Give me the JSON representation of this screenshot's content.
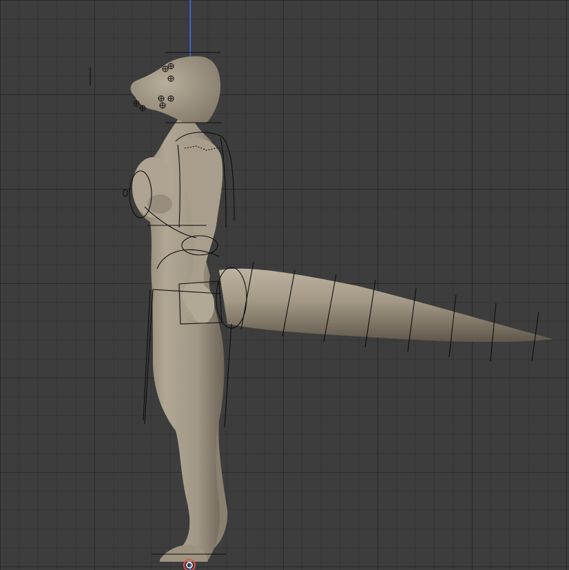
{
  "viewport": {
    "view": "side",
    "background_color": "#3d3d3d",
    "grid_color": "#2a2a2a",
    "axis_color": "#3a6fd8",
    "mesh_color": "#a19786",
    "mesh_shadow_color": "#6e6558",
    "rig_line_color": "#0d0d0d",
    "origin_marker_color": "#e05050"
  },
  "model": {
    "icon": "sculpt-model",
    "rig": "armature-overlay"
  }
}
